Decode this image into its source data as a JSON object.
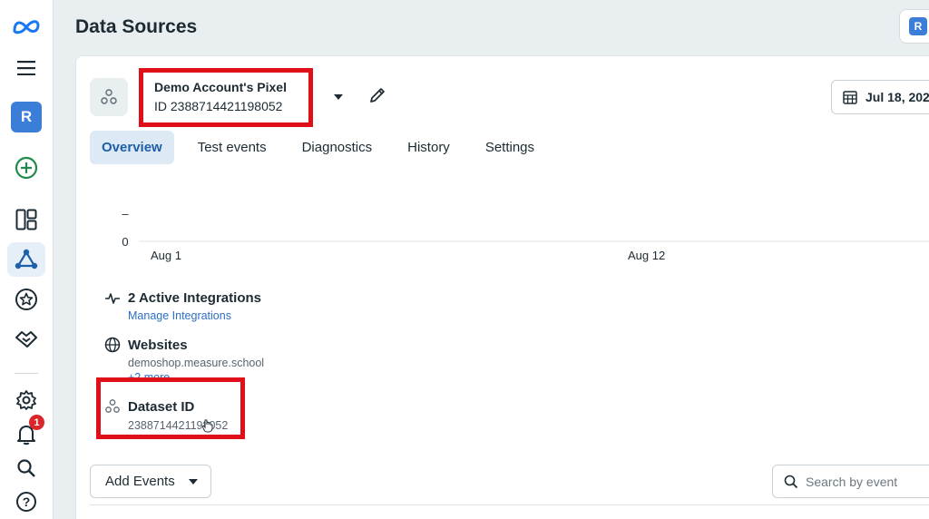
{
  "rail": {
    "logo_icon": "meta-logo-icon",
    "avatar_letter": "R",
    "notification_count": "1"
  },
  "header": {
    "title": "Data Sources",
    "account_letter": "R"
  },
  "pixel": {
    "name": "Demo Account's Pixel",
    "id_text": "ID 2388714421198052"
  },
  "date_range": {
    "label": "Jul 18, 202"
  },
  "tabs": [
    {
      "label": "Overview",
      "active": true
    },
    {
      "label": "Test events",
      "active": false
    },
    {
      "label": "Diagnostics",
      "active": false
    },
    {
      "label": "History",
      "active": false
    },
    {
      "label": "Settings",
      "active": false
    }
  ],
  "chart_data": {
    "type": "line",
    "x_ticks": [
      "Aug 1",
      "Aug 12"
    ],
    "y_ticks": [
      "0",
      "–"
    ],
    "series": []
  },
  "integrations": {
    "title": "2 Active Integrations",
    "link": "Manage Integrations"
  },
  "websites": {
    "title": "Websites",
    "domain": "demoshop.measure.school",
    "more": "+2 more"
  },
  "dataset": {
    "title": "Dataset ID",
    "value": "2388714421198052"
  },
  "actions": {
    "add_events": "Add Events",
    "search_placeholder": "Search by event"
  },
  "colors": {
    "accent_blue": "#1d5fa8",
    "highlight_red": "#e0101a",
    "badge_red": "#d8262a"
  }
}
